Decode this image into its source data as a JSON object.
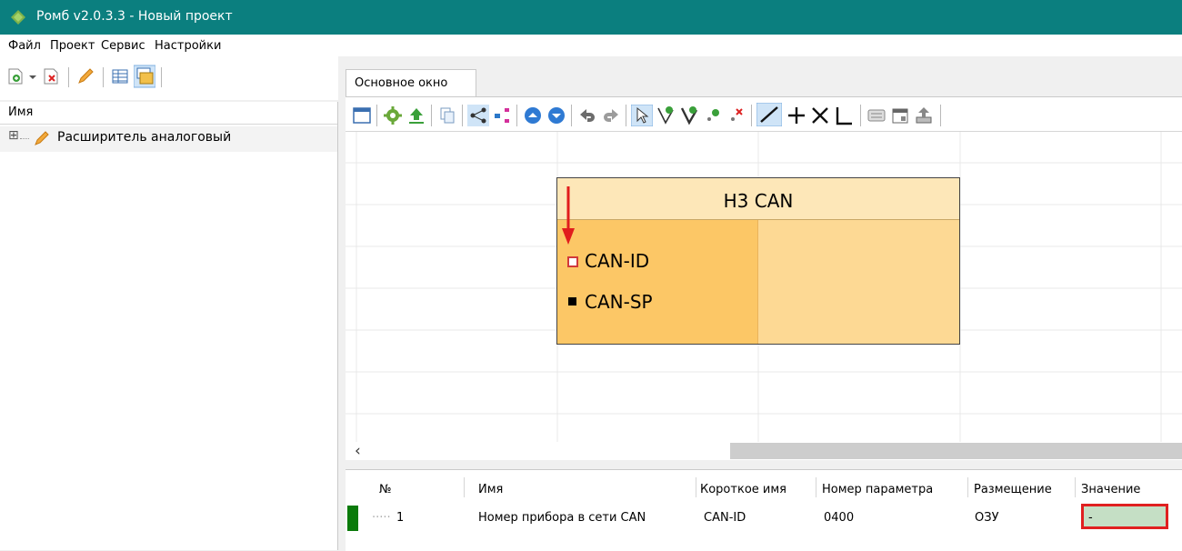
{
  "window": {
    "title": "Ромб v2.0.3.3 - Новый проект",
    "logo_icon": "rhombus-logo-icon",
    "accent": "#0b7f7f"
  },
  "menu": {
    "items": [
      "Файл",
      "Проект",
      "Сервис",
      "Настройки"
    ]
  },
  "left_toolbar": {
    "icons": [
      "add-page-icon",
      "dropdown-arrow-icon",
      "delete-page-icon",
      "pencil-icon",
      "table-icon",
      "windows-icon"
    ]
  },
  "tree": {
    "header": "Имя",
    "items": [
      {
        "expander": "⊞",
        "icon": "pencil-icon",
        "label": "Расширитель аналоговый"
      }
    ]
  },
  "tabs": [
    {
      "label": "Основное окно",
      "active": true
    }
  ],
  "right_toolbar": {
    "icons": [
      "window-icon",
      "gear-icon",
      "upload-icon",
      "copy-icon",
      "tree-icon",
      "branch-icon",
      "up-circle-icon",
      "down-circle-icon",
      "undo-icon",
      "redo-icon",
      "cursor-icon",
      "add-node-icon",
      "move-node-icon",
      "add-point-icon",
      "delete-point-icon",
      "line-icon",
      "plus-icon",
      "cross-icon",
      "angle-icon",
      "keyboard-icon",
      "calendar-icon",
      "export-icon"
    ]
  },
  "diagram": {
    "block": {
      "title": "Н3 CAN",
      "ports": [
        {
          "label": "CAN-ID",
          "marker": "hollow-square",
          "color": "#d23a3a"
        },
        {
          "label": "CAN-SP",
          "marker": "filled-square",
          "color": "#000000"
        }
      ],
      "header_color": "#fde7b8",
      "left_color": "#fcc766",
      "right_color": "#fdd994"
    },
    "annotation_arrow_color": "#e11d1d"
  },
  "scrollbar": {
    "left_arrow": "‹"
  },
  "table": {
    "columns": [
      "№",
      "Имя",
      "Короткое имя",
      "Номер параметра",
      "Размещение",
      "Значение"
    ],
    "rows": [
      {
        "status_color": "#0a7a0a",
        "tree_lines": "·····",
        "num": "1",
        "name": "Номер прибора в сети CAN",
        "short": "CAN-ID",
        "param": "0400",
        "place": "ОЗУ",
        "value": "-",
        "value_bg": "#c5dfc5",
        "highlight": "#e02020"
      }
    ]
  }
}
